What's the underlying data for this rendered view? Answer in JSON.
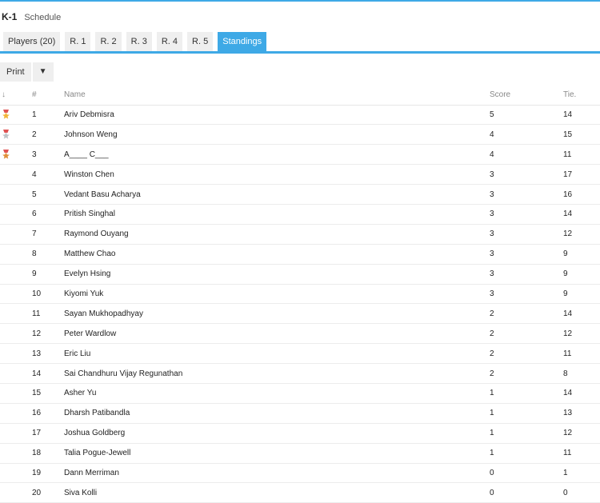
{
  "header": {
    "section": "K-1",
    "schedule_label": "Schedule"
  },
  "tabs": [
    "Players (20)",
    "R. 1",
    "R. 2",
    "R. 3",
    "R. 4",
    "R. 5",
    "Standings"
  ],
  "active_tab": "Standings",
  "toolbar": {
    "print_label": "Print",
    "caret": "▼"
  },
  "columns": {
    "sort": "↓",
    "rank": "#",
    "name": "Name",
    "score": "Score",
    "tie": "Tie."
  },
  "medal_colors": {
    "gold": "#f2b53a",
    "silver": "#bfc4c8",
    "bronze": "#e0903a",
    "ribbon": "#e05252"
  },
  "accent": "#3ea9e6",
  "rows": [
    {
      "rank": "1",
      "name": "Ariv Debmisra",
      "score": "5",
      "tie": "14",
      "medal": "gold"
    },
    {
      "rank": "2",
      "name": "Johnson Weng",
      "score": "4",
      "tie": "15",
      "medal": "silver"
    },
    {
      "rank": "3",
      "name": "A____ C___",
      "score": "4",
      "tie": "11",
      "medal": "bronze"
    },
    {
      "rank": "4",
      "name": "Winston Chen",
      "score": "3",
      "tie": "17"
    },
    {
      "rank": "5",
      "name": "Vedant Basu Acharya",
      "score": "3",
      "tie": "16"
    },
    {
      "rank": "6",
      "name": "Pritish Singhal",
      "score": "3",
      "tie": "14"
    },
    {
      "rank": "7",
      "name": "Raymond Ouyang",
      "score": "3",
      "tie": "12"
    },
    {
      "rank": "8",
      "name": "Matthew Chao",
      "score": "3",
      "tie": "9"
    },
    {
      "rank": "9",
      "name": "Evelyn Hsing",
      "score": "3",
      "tie": "9"
    },
    {
      "rank": "10",
      "name": "Kiyomi Yuk",
      "score": "3",
      "tie": "9"
    },
    {
      "rank": "11",
      "name": "Sayan Mukhopadhyay",
      "score": "2",
      "tie": "14"
    },
    {
      "rank": "12",
      "name": "Peter Wardlow",
      "score": "2",
      "tie": "12"
    },
    {
      "rank": "13",
      "name": "Eric Liu",
      "score": "2",
      "tie": "11"
    },
    {
      "rank": "14",
      "name": "Sai Chandhuru Vijay Regunathan",
      "score": "2",
      "tie": "8"
    },
    {
      "rank": "15",
      "name": "Asher Yu",
      "score": "1",
      "tie": "14"
    },
    {
      "rank": "16",
      "name": "Dharsh Patibandla",
      "score": "1",
      "tie": "13"
    },
    {
      "rank": "17",
      "name": "Joshua Goldberg",
      "score": "1",
      "tie": "12"
    },
    {
      "rank": "18",
      "name": "Talia Pogue-Jewell",
      "score": "1",
      "tie": "11"
    },
    {
      "rank": "19",
      "name": "Dann Merriman",
      "score": "0",
      "tie": "1"
    },
    {
      "rank": "20",
      "name": "Siva Kolli",
      "score": "0",
      "tie": "0"
    }
  ]
}
